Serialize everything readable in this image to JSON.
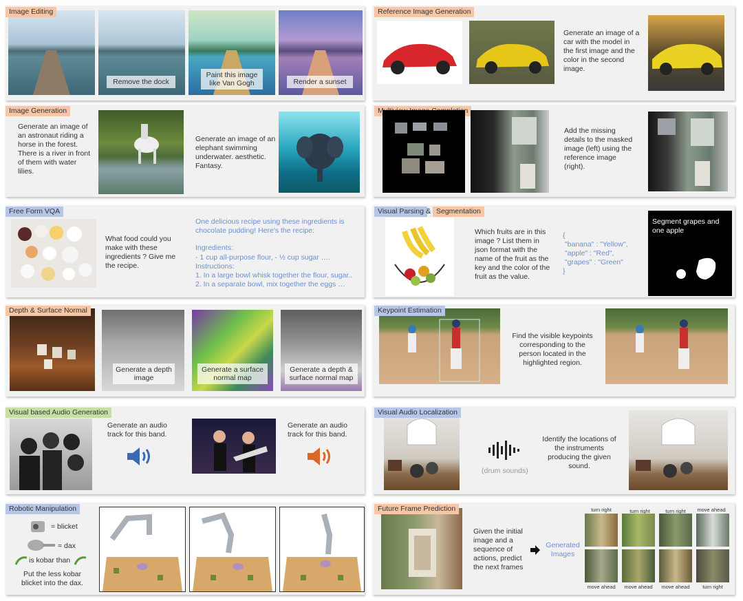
{
  "panels": {
    "image_editing": {
      "title": "Image Editing",
      "cap1": "Remove the dock",
      "cap2": "Paint this image like Van Gogh",
      "cap3": "Render a sunset"
    },
    "reference_gen": {
      "title": "Reference Image Generation",
      "prompt": "Generate an image of a car with the model in the first image and the color in the second image."
    },
    "image_gen": {
      "title": "Image Generation",
      "prompt1": "Generate an image of an astronaut riding a horse in the forest. There is a river in front of them with water lilies.",
      "prompt2": "Generate an image of an elephant swimming underwater. aesthetic. Fantasy."
    },
    "multiview": {
      "title": "Multiview Image Completion",
      "prompt": "Add the missing details to the masked image (left) using the reference image (right)."
    },
    "vqa": {
      "title": "Free Form VQA",
      "question": "What food could you make with these ingredients ? Give me the recipe.",
      "answer": "One delicious recipe using these ingredients is chocolate pudding! Here's the recipe:",
      "ing_title": "Ingredients:",
      "ing": "- 1 cup all-purpose flour, - ½ cup sugar ….",
      "ins_title": "Instructions:",
      "ins1": "1. In a large bowl whisk together the flour, sugar..",
      "ins2": "2. In a separate bowl, mix together the eggs …"
    },
    "parsing": {
      "title1": "Visual Parsing",
      "amp": "&",
      "title2": "Segmentation",
      "question": "Which fruits are in this image ? List them in json format with the name of the fruit as the key and the color of the fruit as the value.",
      "json": "{\n \"banana\" : \"Yellow\",\n \"apple\" : \"Red\",\n \"grapes\" : \"Green\"\n}",
      "seg_prompt": "Segment grapes and one apple"
    },
    "depth": {
      "title": "Depth & Surface Normal",
      "cap1": "Generate a depth image",
      "cap2": "Generate a surface normal map",
      "cap3": "Generate a depth & surface normal map"
    },
    "keypoint": {
      "title": "Keypoint Estimation",
      "prompt": "Find the visible keypoints corresponding to the person located in the highlighted region."
    },
    "audio_gen": {
      "title": "Visual based Audio Generation",
      "prompt1": "Generate an audio track for this band.",
      "prompt2": "Generate an audio track for this band."
    },
    "audio_loc": {
      "title": "Visual Audio Localization",
      "sound": "(drum sounds)",
      "prompt": "Identify the locations of the instruments producing the given sound."
    },
    "robotic": {
      "title": "Robotic Manipulation",
      "l1": "= blicket",
      "l2": "= dax",
      "l3": "is kobar than",
      "instr": "Put the less kobar blicket into the dax."
    },
    "future": {
      "title": "Future Frame Prediction",
      "prompt": "Given the initial image and a sequence of actions, predict the next frames",
      "generated": "Generated Images",
      "top": [
        "turn right",
        "turn right",
        "turn right",
        "move ahead"
      ],
      "bottom": [
        "move ahead",
        "move ahead",
        "move ahead",
        "turn right"
      ]
    }
  }
}
